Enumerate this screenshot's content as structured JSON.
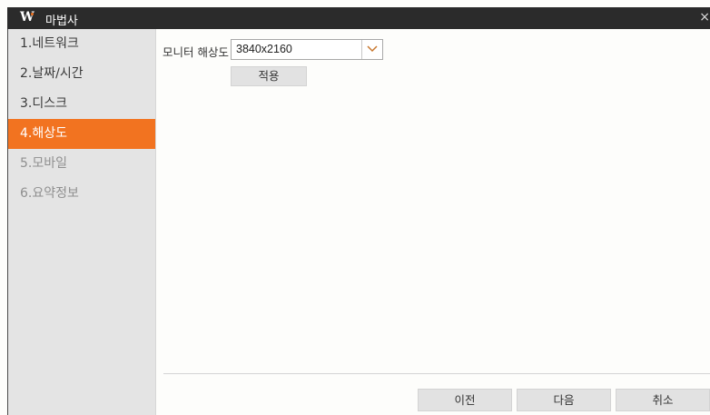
{
  "window": {
    "logo": "W",
    "title": "마법사",
    "close_glyph": "×"
  },
  "sidebar": {
    "items": [
      {
        "label": "1.네트워크",
        "state": "normal"
      },
      {
        "label": "2.날짜/시간",
        "state": "normal"
      },
      {
        "label": "3.디스크",
        "state": "normal"
      },
      {
        "label": "4.해상도",
        "state": "active"
      },
      {
        "label": "5.모바일",
        "state": "disabled"
      },
      {
        "label": "6.요약정보",
        "state": "disabled"
      }
    ]
  },
  "main": {
    "monitor_resolution_label": "모니터 해상도",
    "resolution_value": "3840x2160",
    "apply_label": "적용"
  },
  "footer": {
    "prev_label": "이전",
    "next_label": "다음",
    "cancel_label": "취소"
  },
  "colors": {
    "accent": "#f27320",
    "titlebar": "#2b2b2b",
    "sidebar_bg": "#e4e4e4"
  },
  "icons": {
    "dropdown": "chevron-down-icon",
    "close": "close-icon"
  }
}
